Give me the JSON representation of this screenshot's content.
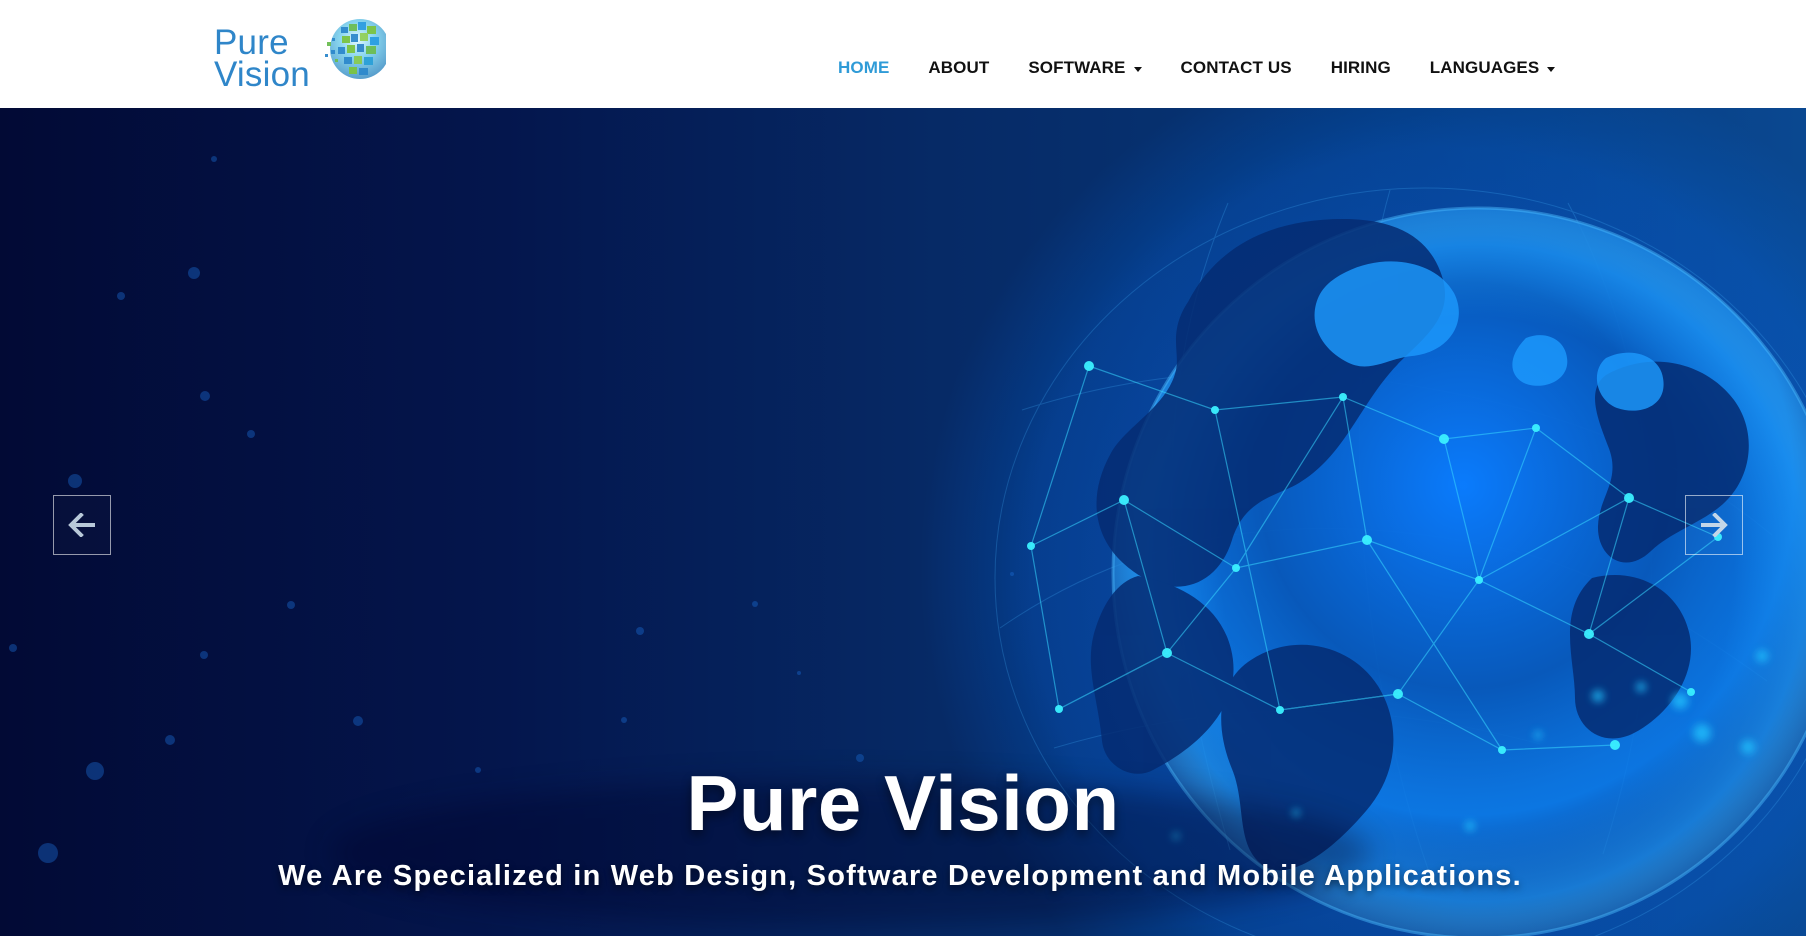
{
  "site": {
    "logo_text_top": "Pure",
    "logo_text_bottom": "Vision",
    "logo_icon": "globe-mosaic-icon",
    "brand_color": "#2f86c9"
  },
  "nav": {
    "items": [
      {
        "label": "HOME",
        "active": true,
        "dropdown": false
      },
      {
        "label": "ABOUT",
        "active": false,
        "dropdown": false
      },
      {
        "label": "SOFTWARE",
        "active": false,
        "dropdown": true
      },
      {
        "label": "CONTACT US",
        "active": false,
        "dropdown": false
      },
      {
        "label": "HIRING",
        "active": false,
        "dropdown": false
      },
      {
        "label": "LANGUAGES",
        "active": false,
        "dropdown": true
      }
    ],
    "active_color": "#2f9bd7",
    "text_color": "#111111",
    "caret_icon": "chevron-down-icon"
  },
  "hero": {
    "title": "Pure Vision",
    "subtitle": "We Are Specialized in Web Design, Software Development and Mobile Applications.",
    "background_theme": "blue-digital-globe",
    "accent_colors": [
      "#020a35",
      "#063778",
      "#1890ff",
      "#00d5ff"
    ],
    "previous_icon": "arrow-left-icon",
    "next_icon": "arrow-right-icon"
  }
}
